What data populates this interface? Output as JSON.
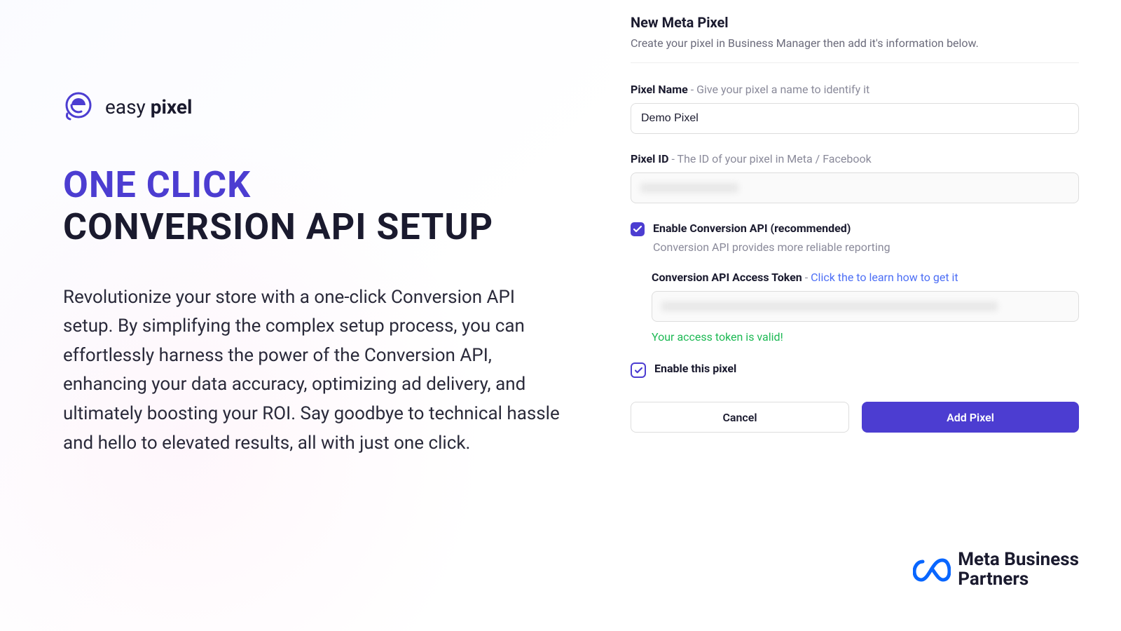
{
  "left": {
    "logo_text_light": "easy ",
    "logo_text_bold": "pixel",
    "headline_accent": "ONE CLICK",
    "headline_main": "CONVERSION API SETUP",
    "description": "Revolutionize your store with a one-click Conversion API setup. By simplifying the complex setup process, you can effortlessly harness the power of the Conversion API, enhancing your data accuracy, optimizing ad delivery, and ultimately boosting your ROI. Say goodbye to technical hassle and hello to elevated results, all with just one click."
  },
  "form": {
    "title": "New Meta Pixel",
    "subtitle": "Create your pixel in Business Manager then add it's information below.",
    "pixel_name": {
      "label": "Pixel Name",
      "hint": " - Give your pixel a name to identify it",
      "value": "Demo Pixel"
    },
    "pixel_id": {
      "label": "Pixel ID",
      "hint": " - The ID of your pixel in Meta / Facebook",
      "value": ""
    },
    "enable_capi": {
      "label": "Enable Conversion API (recommended)",
      "sub": "Conversion API provides more reliable reporting",
      "checked": true
    },
    "capi_token": {
      "label": "Conversion API Access Token",
      "hint_prefix": " - ",
      "link": "Click the to learn how to get it",
      "valid_msg": "Your access token is valid!"
    },
    "enable_pixel": {
      "label": "Enable this pixel",
      "checked": true
    },
    "buttons": {
      "cancel": "Cancel",
      "submit": "Add Pixel"
    }
  },
  "footer": {
    "meta_line1": "Meta Business",
    "meta_line2": "Partners"
  }
}
